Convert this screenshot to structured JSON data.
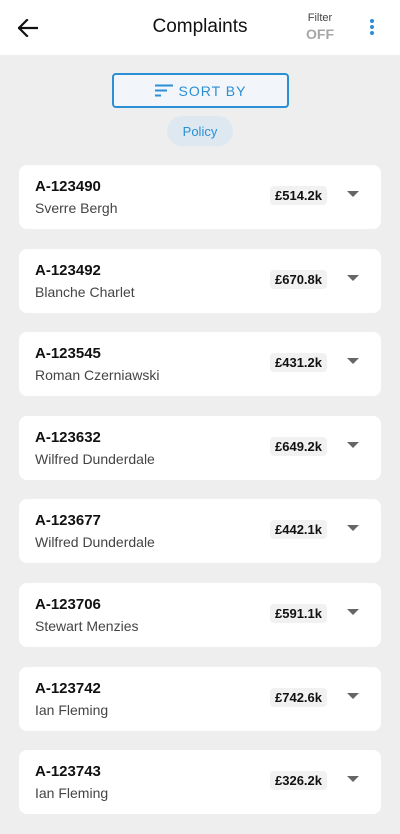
{
  "header": {
    "title": "Complaints",
    "filter_label": "Filter",
    "filter_value": "OFF"
  },
  "sort": {
    "label": "SORT BY",
    "active_chip": "Policy"
  },
  "icons": {
    "back": "arrow-left-icon",
    "more": "more-vert-icon",
    "sort": "sort-lines-icon",
    "expand": "chevron-down-icon"
  },
  "colors": {
    "accent": "#2b8fd6",
    "background": "#eeeeee",
    "card": "#ffffff"
  },
  "complaints": [
    {
      "id": "A-123490",
      "name": "Sverre Bergh",
      "amount": "£514.2k"
    },
    {
      "id": "A-123492",
      "name": "Blanche Charlet",
      "amount": "£670.8k"
    },
    {
      "id": "A-123545",
      "name": "Roman Czerniawski",
      "amount": "£431.2k"
    },
    {
      "id": "A-123632",
      "name": "Wilfred Dunderdale",
      "amount": "£649.2k"
    },
    {
      "id": "A-123677",
      "name": "Wilfred Dunderdale",
      "amount": "£442.1k"
    },
    {
      "id": "A-123706",
      "name": "Stewart Menzies",
      "amount": "£591.1k"
    },
    {
      "id": "A-123742",
      "name": "Ian Fleming",
      "amount": "£742.6k"
    },
    {
      "id": "A-123743",
      "name": "Ian Fleming",
      "amount": "£326.2k"
    }
  ]
}
